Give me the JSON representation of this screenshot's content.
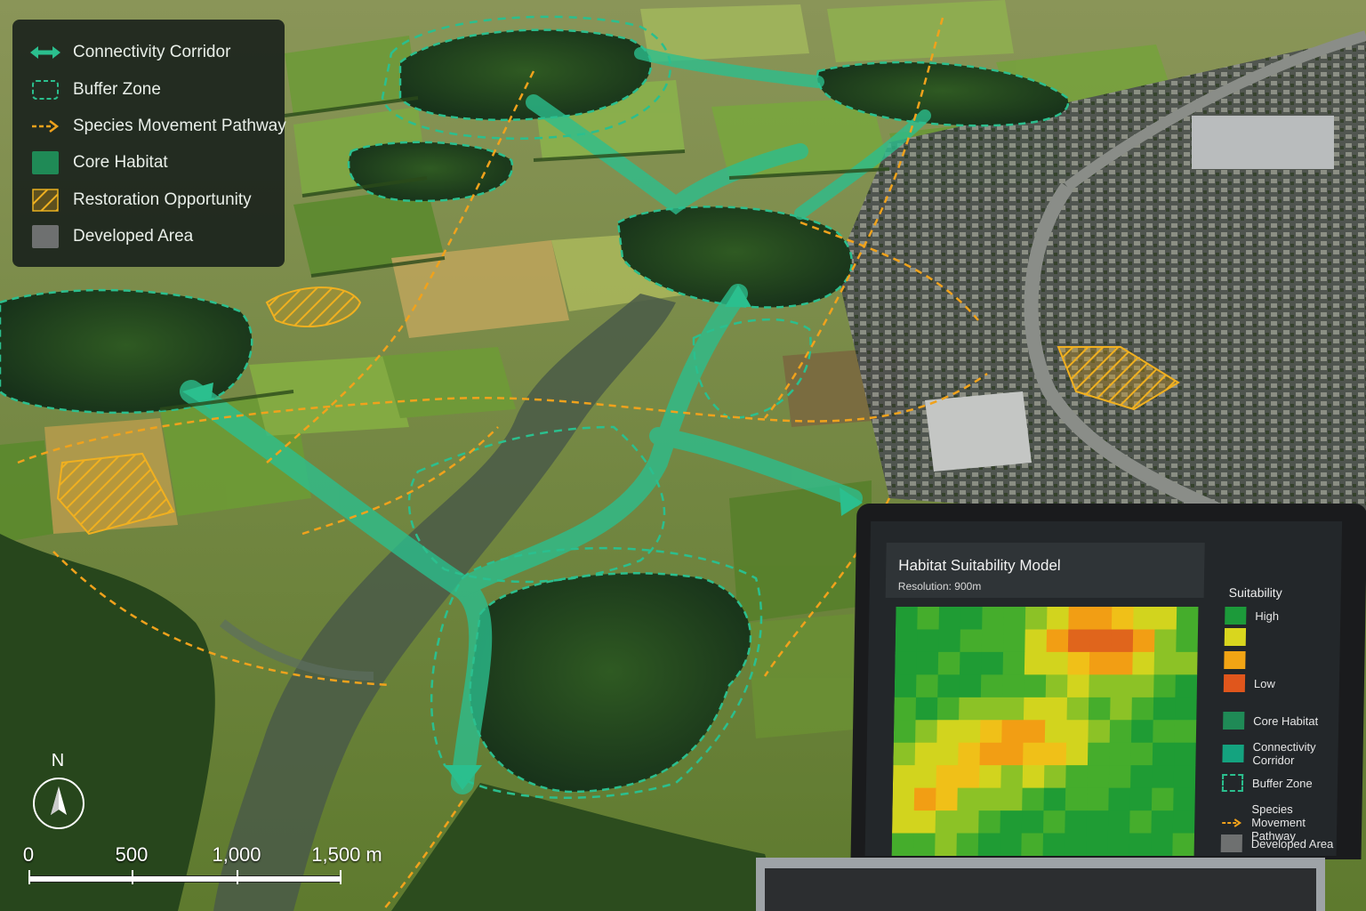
{
  "legend": {
    "items": [
      {
        "label": "Connectivity Corridor",
        "icon": "double-arrow-icon",
        "color": "#2bbf8e"
      },
      {
        "label": "Buffer Zone",
        "icon": "dashed-box-icon",
        "color": "#2bbf8e"
      },
      {
        "label": "Species Movement Pathway",
        "icon": "dashed-arrow-icon",
        "color": "#f0a21c"
      },
      {
        "label": "Core Habitat",
        "icon": "solid-square-icon",
        "color": "#1f8a56"
      },
      {
        "label": "Restoration Opportunity",
        "icon": "hatched-square-icon",
        "color": "#e8b020"
      },
      {
        "label": "Developed Area",
        "icon": "gray-square-icon",
        "color": "#6e7070"
      }
    ]
  },
  "compass": {
    "label": "N"
  },
  "scalebar": {
    "labels": [
      "0",
      "500",
      "1,000",
      "1,500 m"
    ]
  },
  "model": {
    "title": "Habitat Suitability Model",
    "resolution": "Resolution: 900m",
    "legend_title": "Suitability",
    "scale_high": "High",
    "scale_low": "Low",
    "scale_colors": [
      "#1c9a3a",
      "#d9d61e",
      "#f2a414",
      "#e0561c"
    ],
    "items": [
      {
        "label": "Core Habitat",
        "color": "#1f8a56"
      },
      {
        "label": "Connectivity Corridor",
        "color": "#14a37f"
      },
      {
        "label": "Buffer Zone",
        "color": "#2bbf8e"
      },
      {
        "label": "Species Movement Pathway",
        "color": "#f0a21c"
      },
      {
        "label": "Developed Area",
        "color": "#6e7070"
      }
    ]
  },
  "colors": {
    "corridor": "#2bbf8e",
    "pathway": "#f0a21c",
    "core": "#1e4a1e",
    "restoration": "#e8b020"
  }
}
